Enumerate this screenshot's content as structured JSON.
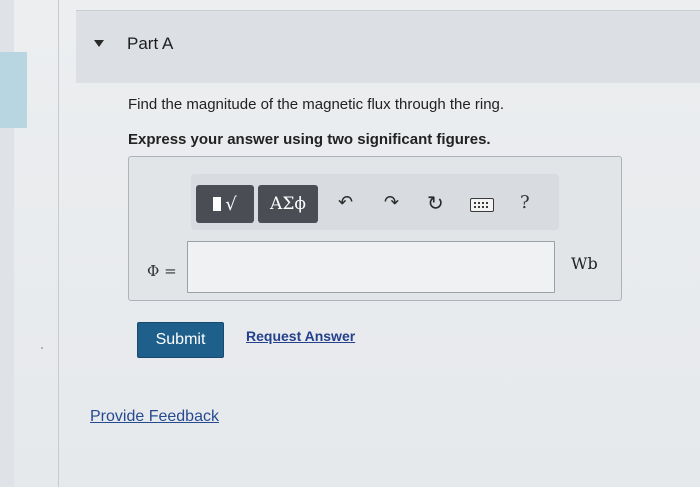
{
  "part": {
    "title": "Part A"
  },
  "problem": {
    "question": "Find the magnitude of the magnetic flux through the ring.",
    "instruction": "Express your answer using two significant figures."
  },
  "toolbar": {
    "templates_icon": "templates-sqrt-icon",
    "templates_label": "√",
    "greek_label": "ΑΣϕ",
    "undo_icon": "undo-icon",
    "undo_glyph": "↶",
    "redo_icon": "redo-icon",
    "redo_glyph": "↷",
    "reset_icon": "reset-icon",
    "reset_glyph": "↻",
    "keyboard_icon": "keyboard-icon",
    "help_label": "?"
  },
  "answer": {
    "variable_label": "Φ =",
    "value": "",
    "unit": "Wb"
  },
  "actions": {
    "submit_label": "Submit",
    "request_label": "Request Answer"
  },
  "footer": {
    "feedback_label": "Provide Feedback"
  },
  "colors": {
    "submit_bg": "#1f5f8b",
    "link": "#25408c",
    "accent_left": "#b7d6e1"
  }
}
